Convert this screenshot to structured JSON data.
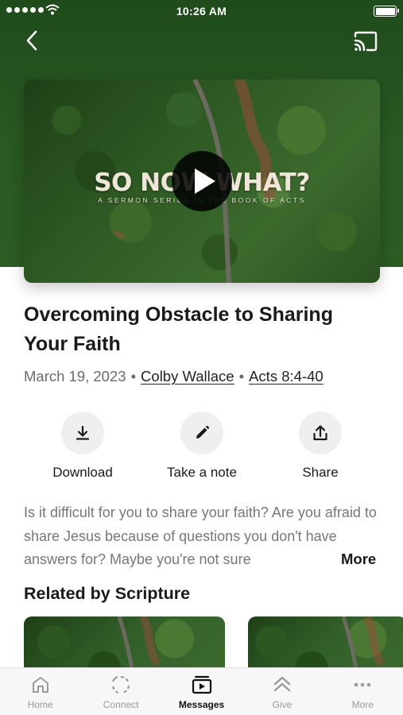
{
  "status_bar": {
    "time": "10:26 AM"
  },
  "nav": {
    "back_icon": "chevron-left-icon",
    "cast_icon": "cast-icon"
  },
  "video": {
    "title_art": "SO NOW WHAT?",
    "subtitle_art": "A SERMON SERIES IN THE BOOK OF ACTS"
  },
  "sermon": {
    "title": "Overcoming Obstacle to Sharing Your Faith",
    "date": "March 19, 2023",
    "speaker": "Colby Wallace",
    "scripture": "Acts 8:4-40",
    "separator": "•"
  },
  "actions": [
    {
      "label": "Download",
      "icon": "download-icon"
    },
    {
      "label": "Take a note",
      "icon": "pencil-icon"
    },
    {
      "label": "Share",
      "icon": "share-icon"
    }
  ],
  "description": {
    "text": "Is it difficult for you to share your faith? Are you afraid to share Jesus because of questions you don't have answers for? Maybe you're not sure",
    "more_label": "More"
  },
  "related": {
    "title": "Related by Scripture"
  },
  "tabs": [
    {
      "label": "Home",
      "icon": "home-icon",
      "active": false
    },
    {
      "label": "Connect",
      "icon": "connect-icon",
      "active": false
    },
    {
      "label": "Messages",
      "icon": "messages-icon",
      "active": true
    },
    {
      "label": "Give",
      "icon": "give-icon",
      "active": false
    },
    {
      "label": "More",
      "icon": "more-icon",
      "active": false
    }
  ],
  "colors": {
    "header_green": "#2a5a23",
    "icon_gray": "#1a1a1a",
    "inactive_tab": "#9a9a9a"
  }
}
